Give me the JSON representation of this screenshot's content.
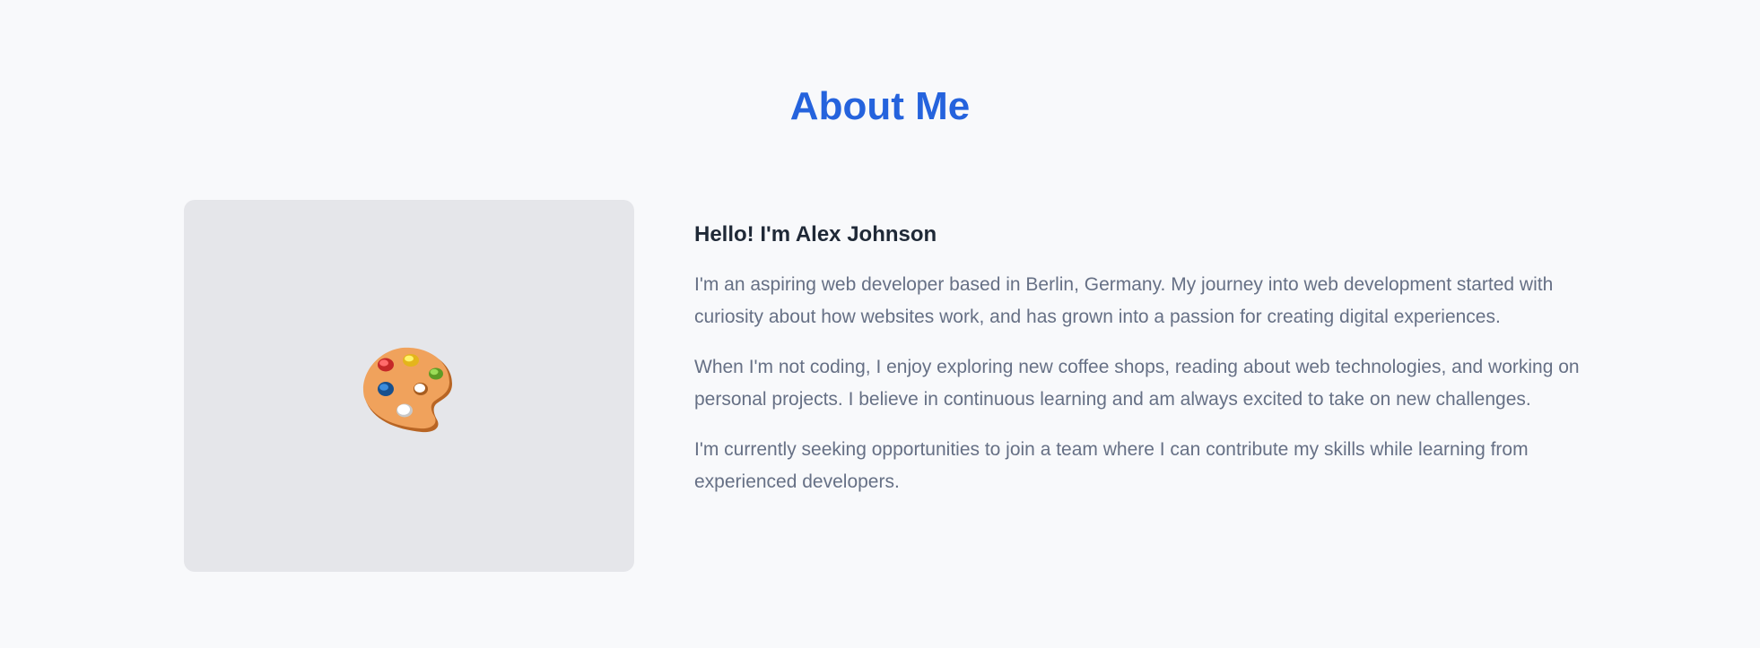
{
  "about": {
    "title": "About Me",
    "image": {
      "icon": "artist-palette-icon"
    },
    "greeting": "Hello! I'm Alex Johnson",
    "paragraphs": [
      "I'm an aspiring web developer based in Berlin, Germany. My journey into web development started with curiosity about how websites work, and has grown into a passion for creating digital experiences.",
      "When I'm not coding, I enjoy exploring new coffee shops, reading about web technologies, and working on personal projects. I believe in continuous learning and am always excited to take on new challenges.",
      "I'm currently seeking opportunities to join a team where I can contribute my skills while learning from experienced developers."
    ]
  },
  "colors": {
    "page_background": "#f8f9fb",
    "title": "#2563dd",
    "heading": "#1f2937",
    "body_text": "#667085",
    "image_placeholder": "#e5e6ea",
    "palette": "#f0a25c"
  }
}
